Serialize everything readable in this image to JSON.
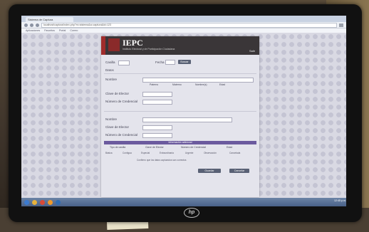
{
  "browser": {
    "tab_title": "Sistema de Captura",
    "url": "localhost/captura/index.php?m=sistema&a=captura&id=123",
    "bookmarks": [
      "Aplicaciones",
      "Favoritos",
      "Portal",
      "Correo"
    ]
  },
  "header": {
    "brand": "IEPC",
    "brand_sub": "Instituto Electoral y de Participación Ciudadana",
    "right_label": "Salir"
  },
  "form": {
    "casilla_label": "Casilla",
    "fecha_label": "Fecha",
    "buscar_button": "Buscar",
    "datos_label": "Datos",
    "nombre_label_1": "Nombre",
    "clave_elector_label_1": "Clave de Elector",
    "numero_credencial_label_1": "Número de Credencial",
    "col_headers_1": [
      "Paterno",
      "Materno",
      "Nombre(s)",
      "Edad"
    ],
    "nombre_label_2": "Nombre",
    "clave_elector_label_2": "Clave de Elector",
    "numero_credencial_label_2": "Número de Credencial",
    "purple_bar_label": "Información adicional",
    "col_headers_2": [
      "Tipo de casilla",
      "Clave de Elector",
      "Número de Credencial",
      "Edad"
    ],
    "options": [
      "Básica",
      "Contigua",
      "Especial",
      "Extraordinaria",
      "Urgente",
      "Observación",
      "Cancelada"
    ],
    "note_line": "Confirmo que los datos capturados son correctos",
    "save_button": "Guardar",
    "cancel_button": "Cancelar"
  },
  "taskbar": {
    "tray_time": "12:45 p.m."
  },
  "colors": {
    "header_bg": "#3a3638",
    "accent_red": "#a02c2c",
    "purple_bar": "#6b5a9e",
    "button": "#596175"
  }
}
